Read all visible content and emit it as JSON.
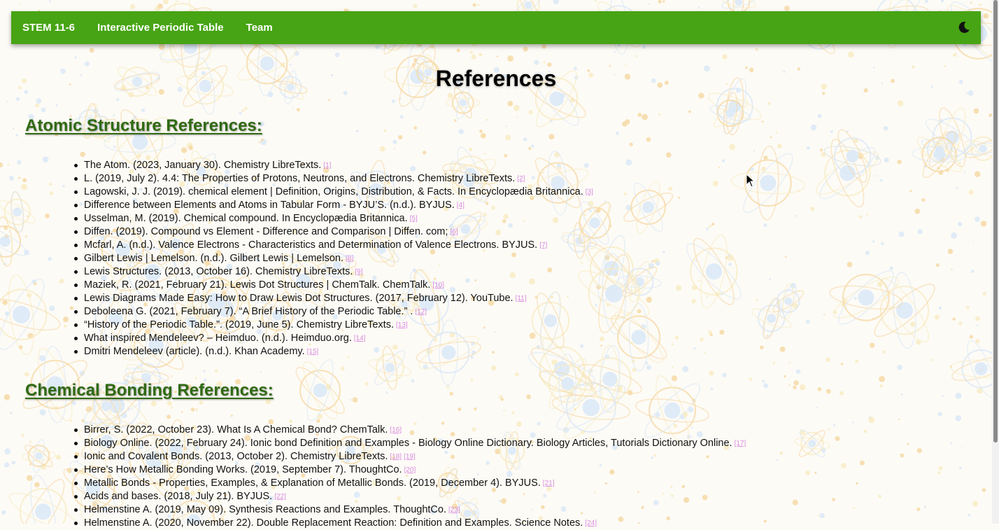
{
  "nav": {
    "links": [
      "STEM 11-6",
      "Interactive Periodic Table",
      "Team"
    ],
    "theme_toggle_icon": "moon-icon"
  },
  "page": {
    "title": "References"
  },
  "sections": [
    {
      "heading": "Atomic Structure References:",
      "refs": [
        {
          "text": "The Atom. (2023, January 30). Chemistry LibreTexts.",
          "links": [
            "[1]"
          ]
        },
        {
          "text": "L. (2019, July 2).  4.4: The Properties of Protons, Neutrons, and Electrons. Chemistry LibreTexts.",
          "links": [
            "[2]"
          ]
        },
        {
          "text": "Lagowski, J. J. (2019). chemical element | Definition, Origins, Distribution, & Facts. In Encyclopædia Britannica.",
          "links": [
            "[3]"
          ]
        },
        {
          "text": "Difference between Elements and Atoms in Tabular Form - BYJU’S. (n.d.). BYJUS.",
          "links": [
            "[4]"
          ]
        },
        {
          "text": "Usselman, M. (2019). Chemical compound. In Encyclopædia Britannica.",
          "links": [
            "[5]"
          ]
        },
        {
          "text": "Diffen. (2019). Compound vs Element - Difference and Comparison | Diffen. com;",
          "links": [
            "[6]"
          ]
        },
        {
          "text": "Mcfarl, A. (n.d.). Valence Electrons - Characteristics and Determination of Valence Electrons. BYJUS.",
          "links": [
            "[7]"
          ]
        },
        {
          "text": "Gilbert Lewis | Lemelson. (n.d.). Gilbert Lewis | Lemelson.",
          "links": [
            "[8]"
          ]
        },
        {
          "text": "Lewis Structures. (2013, October 16). Chemistry LibreTexts.",
          "links": [
            "[9]"
          ]
        },
        {
          "text": "Maziek, R. (2021, February 21). Lewis Dot Structures | ChemTalk. ChemTalk.",
          "links": [
            "[10]"
          ]
        },
        {
          "text": "Lewis Diagrams Made Easy: How to Draw Lewis Dot Structures. (2017, February 12). YouTube.",
          "links": [
            "[11]"
          ]
        },
        {
          "text": "Deboleena G. (2021, February 7).  “A Brief History of the Periodic Table.” .",
          "links": [
            "[12]"
          ]
        },
        {
          "text": "“History of the Periodic Table.”. (2019, June 5).  Chemistry LibreTexts.",
          "links": [
            "[13]"
          ]
        },
        {
          "text": "What inspired Mendeleev? – Heimduo. (n.d.). Heimduo.org.",
          "links": [
            "[14]"
          ]
        },
        {
          "text": "Dmitri Mendeleev (article). (n.d.). Khan Academy.",
          "links": [
            "[15]"
          ]
        }
      ]
    },
    {
      "heading": "Chemical Bonding References:",
      "refs": [
        {
          "text": "Birrer, S. (2022, October 23). What Is A Chemical Bond? ChemTalk.",
          "links": [
            "[16]"
          ]
        },
        {
          "text": "Biology Online. (2022, February 24). Ionic bond Definition and Examples - Biology Online Dictionary. Biology Articles, Tutorials Dictionary Online.",
          "links": [
            "[17]"
          ]
        },
        {
          "text": "Ionic and Covalent Bonds. (2013, October 2). Chemistry LibreTexts.",
          "links": [
            "[18]",
            "[19]"
          ]
        },
        {
          "text": "Here’s How Metallic Bonding Works. (2019, September 7). ThoughtCo.",
          "links": [
            "[20]"
          ]
        },
        {
          "text": "Metallic Bonds - Properties, Examples, & Explanation of Metallic Bonds. (2019, December 4). BYJUS.",
          "links": [
            "[21]"
          ]
        },
        {
          "text": "Acids and bases. (2018, July 21). BYJUS.",
          "links": [
            "[22]"
          ]
        },
        {
          "text": "Helmenstine A. (2019, May 09). Synthesis Reactions and Examples. ThoughtCo.",
          "links": [
            "[23]"
          ]
        },
        {
          "text": "Helmenstine A. (2020, November 22). Double Replacement Reaction: Definition and Examples. Science Notes.",
          "links": [
            "[24]"
          ]
        }
      ]
    }
  ],
  "colors": {
    "navbar": "#47a414",
    "heading": "#2f6a12",
    "ref_link": "#d88be0",
    "bg_blue": "#dbe9f7",
    "bg_orange": "#f6d9a6",
    "bg_yellow": "#f8ecc4"
  }
}
